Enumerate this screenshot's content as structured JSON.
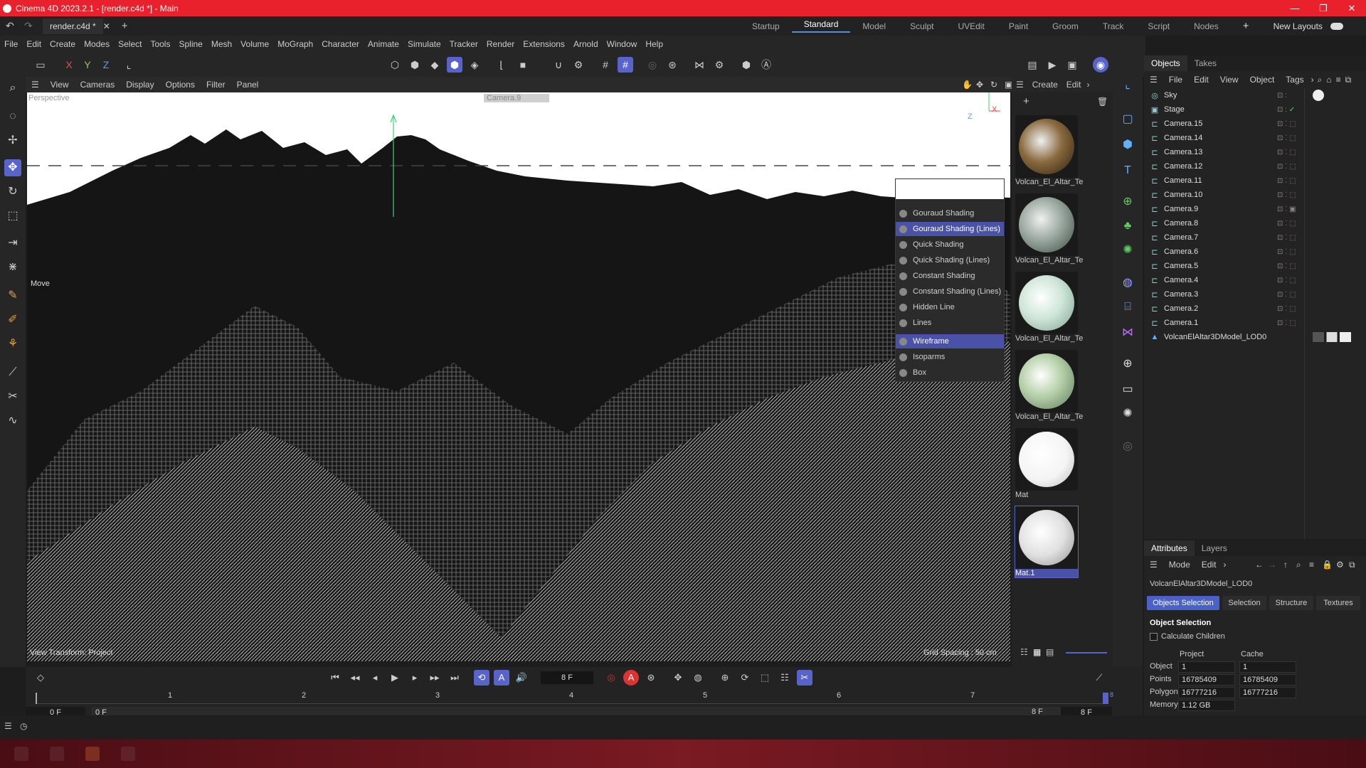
{
  "app": {
    "title": "Cinema 4D 2023.2.1 - [render.c4d *] - Main",
    "doc_tab": "render.c4d *",
    "window_controls": [
      "—",
      "❐",
      "✕"
    ]
  },
  "layouts": {
    "items": [
      "Startup",
      "Standard",
      "Model",
      "Sculpt",
      "UVEdit",
      "Paint",
      "Groom",
      "Track",
      "Script",
      "Nodes"
    ],
    "active": "Standard",
    "new_layouts": "New Layouts"
  },
  "menubar": [
    "File",
    "Edit",
    "Create",
    "Modes",
    "Select",
    "Tools",
    "Spline",
    "Mesh",
    "Volume",
    "MoGraph",
    "Character",
    "Animate",
    "Simulate",
    "Tracker",
    "Render",
    "Extensions",
    "Arnold",
    "Window",
    "Help"
  ],
  "toolbar": {
    "axis_x": "X",
    "axis_y": "Y",
    "axis_z": "Z"
  },
  "viewport": {
    "menu": [
      "View",
      "Cameras",
      "Display",
      "Options",
      "Filter",
      "Panel"
    ],
    "label_perspective": "Perspective",
    "label_camera": "Camera.9",
    "move_label": "Move",
    "view_transform": "View Transform: Project",
    "grid_spacing": "Grid Spacing : 50 cm",
    "axis_z": "Z",
    "axis_x": "X"
  },
  "shading_menu": {
    "items": [
      {
        "label": "Gouraud Shading",
        "selected": false
      },
      {
        "label": "Gouraud Shading (Lines)",
        "selected": true
      },
      {
        "label": "Quick Shading",
        "selected": false
      },
      {
        "label": "Quick Shading (Lines)",
        "selected": false
      },
      {
        "label": "Constant Shading",
        "selected": false
      },
      {
        "label": "Constant Shading (Lines)",
        "selected": false
      },
      {
        "label": "Hidden Line",
        "selected": false
      },
      {
        "label": "Lines",
        "selected": false
      },
      {
        "label": "Wireframe",
        "selected": true
      },
      {
        "label": "Isoparms",
        "selected": false
      },
      {
        "label": "Box",
        "selected": false
      }
    ]
  },
  "materials": {
    "menu": [
      "Create",
      "Edit"
    ],
    "items": [
      {
        "name": "Volcan_El_Altar_Te",
        "color": "#8a6a3e"
      },
      {
        "name": "Volcan_El_Altar_Te",
        "color": "#9aa8a0"
      },
      {
        "name": "Volcan_El_Altar_Te",
        "color": "#cfe6d8"
      },
      {
        "name": "Volcan_El_Altar_Te",
        "color": "#b5cfa8"
      },
      {
        "name": "Mat",
        "color": "#f4f4f4"
      },
      {
        "name": "Mat.1",
        "color": "#e0e0e0"
      }
    ]
  },
  "objects_panel": {
    "tabs": [
      "Objects",
      "Takes"
    ],
    "menu": [
      "File",
      "Edit",
      "View",
      "Object",
      "Tags"
    ],
    "rows": [
      "Sky",
      "Stage",
      "Camera.15",
      "Camera.14",
      "Camera.13",
      "Camera.12",
      "Camera.11",
      "Camera.10",
      "Camera.9",
      "Camera.8",
      "Camera.7",
      "Camera.6",
      "Camera.5",
      "Camera.4",
      "Camera.3",
      "Camera.2",
      "Camera.1",
      "VolcanElAltar3DModel_LOD0"
    ]
  },
  "attributes": {
    "tabs": [
      "Attributes",
      "Layers"
    ],
    "menu": [
      "Mode",
      "Edit"
    ],
    "object_name": "VolcanElAltar3DModel_LOD0",
    "buttons": [
      "Objects Selection",
      "Selection",
      "Structure",
      "Textures"
    ],
    "section": "Object Selection",
    "calc_children": "Calculate Children",
    "col_project": "Project",
    "col_cache": "Cache",
    "rows": [
      {
        "label": "Object",
        "project": "1",
        "cache": "1"
      },
      {
        "label": "Points",
        "project": "16785409",
        "cache": "16785409"
      },
      {
        "label": "Polygons",
        "project": "16777216",
        "cache": "16777216"
      },
      {
        "label": "Memory",
        "project": "1.12 GB",
        "cache": ""
      }
    ]
  },
  "timeline": {
    "current_frame": "8 F",
    "ticks": [
      "1",
      "2",
      "3",
      "4",
      "5",
      "6",
      "7"
    ],
    "start_a": "0 F",
    "start_b": "0 F",
    "end_a": "8 F",
    "end_b": "8 F",
    "end_marker": "8"
  }
}
